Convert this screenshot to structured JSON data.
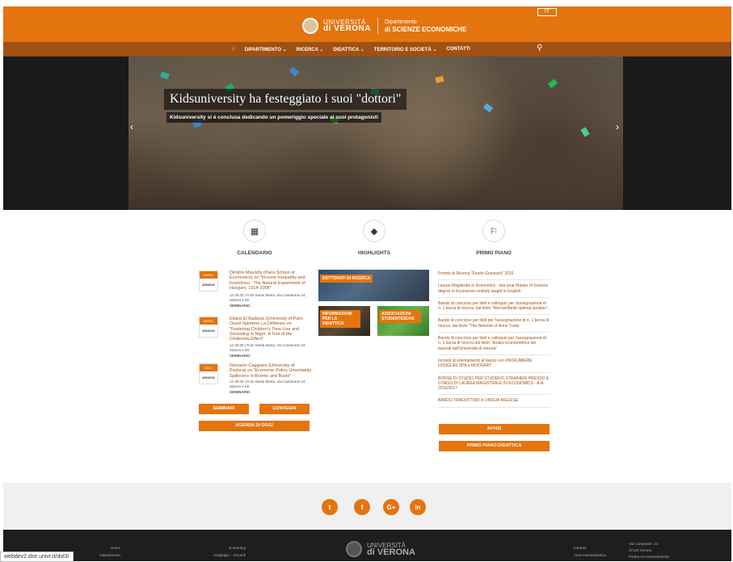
{
  "header": {
    "lang": "IT",
    "uni_line1": "UNIVERSITÀ",
    "uni_line2": "di VERONA",
    "dept_line1": "Dipartimento",
    "dept_line2": "di SCIENZE ECONOMICHE"
  },
  "nav": {
    "items": [
      "DIPARTIMENTO ⌄",
      "RICERCA ⌄",
      "DIDATTICA ⌄",
      "TERRITORIO E SOCIETÀ ⌄",
      "CONTATTI"
    ]
  },
  "hero": {
    "title": "Kidsuniversity ha festeggiato i suoi \"dottori\"",
    "subtitle": "Kidsuniversity si è conclusa dedicando un pomeriggio speciale ai suoi protagonisti"
  },
  "columns": {
    "calendario": "CALENDARIO",
    "highlights": "HIGHLIGHTS",
    "primo_piano": "PRIMO PIANO"
  },
  "events": [
    {
      "month": "MERC",
      "date": "4/5/2016",
      "title": "Dimitris Mavridis (Paris School of Economics) on \"Income Inequality and Incentives - The Natural Experiment of Hungary, 1914-2008\"",
      "place": "12.30.00 | Polo Santa Marta, Via Cantarane 24, Stanza 1.59",
      "type": "SEMINARIO"
    },
    {
      "month": "MERC",
      "date": "4/5/2016",
      "title": "Eliane El Badaoui (University of Paris Ouest Nanterre La Défense) on \"Fostering Children's Time Use and Schooling in Niger: A Tool of the Cinderella Effect\"",
      "place": "12.30.00 | Polo Santa Marta, Via Cantarane 24, Stanza 1.59",
      "type": "SEMINARIO"
    },
    {
      "month": "GIOV",
      "date": "4/5/2016",
      "title": "Giovanni Caggiano (University of Padova) on \"Economic Policy Uncertainty Spillovers in Booms and Busts\"",
      "place": "12.30.00 | Polo Santa Marta, Via Cantarane 24, Stanza 1.59",
      "type": "SEMINARIO"
    }
  ],
  "buttons": {
    "seminari": "SEMINARI",
    "convegni": "CONVEGNI",
    "agenda": "AGENDA DI OGGI",
    "avvisi": "AVVISI",
    "primo_piano_didattica": "PRIMO PIANO DIDATTICA"
  },
  "highlights": {
    "dottorati": "DOTTORATI DI RICERCA",
    "informazioni": "INFORMAZIONI PER LA DIDATTICA",
    "associazioni": "ASSOCIAZIONI STUDENTESCHE"
  },
  "primo_piano": [
    "Premio di Ricerca \"Fondo Gianesini\" 2016",
    "Laurea Magistrale in Economics - two-year Master of Science degree in Economics entirely taught in English",
    "Bando di concorso per titoli e colloquio per l'assegnazione di n. 1 borsa di ricerca, dal titolo \"Non-welfarist optimal taxation\".",
    "Bando di concorso per titoli per l'assegnazione di n. 1 borsa di ricerca, dal titolo \"The Network of Arms Trade",
    "Bando di concorso per titoli e colloquio per l'assegnazione di n. 1 borsa di ricerca dal titolo \"Analisi econometrica dei laureati dell'Università di Verona\"",
    "Incontri di orientamento al lavoro con PROFUMERIE DOUGLAS SPA e MOODART",
    "BORSE DI STUDIO PER STUDENTI STRANIERI PRESSO IL CORSO DI LAUREA MAGISTRALE IN ECONOMICS - A.A. 2016/2017",
    "BANDO TRADUTTORI in LINGUA INGLESE"
  ],
  "social": {
    "twitter": "t",
    "facebook": "f",
    "google": "G+",
    "linkedin": "in"
  },
  "footer": {
    "col1": [
      "Home",
      "Dipartimento"
    ],
    "col2": [
      "E-learning",
      "Antiplagio – Docenti"
    ],
    "col3": [
      "Intranet",
      "Area Amministrativa"
    ],
    "address": [
      "Via Cantarane, 24",
      "37129 Verona",
      "Partita IVA 01541040232"
    ],
    "uni_line1": "UNIVERSITÀ",
    "uni_line2": "di VERONA"
  },
  "status_url": "webdev2.dse.univr.it/dol3/",
  "colors": {
    "accent": "#e4740e",
    "nav": "#a05012"
  }
}
